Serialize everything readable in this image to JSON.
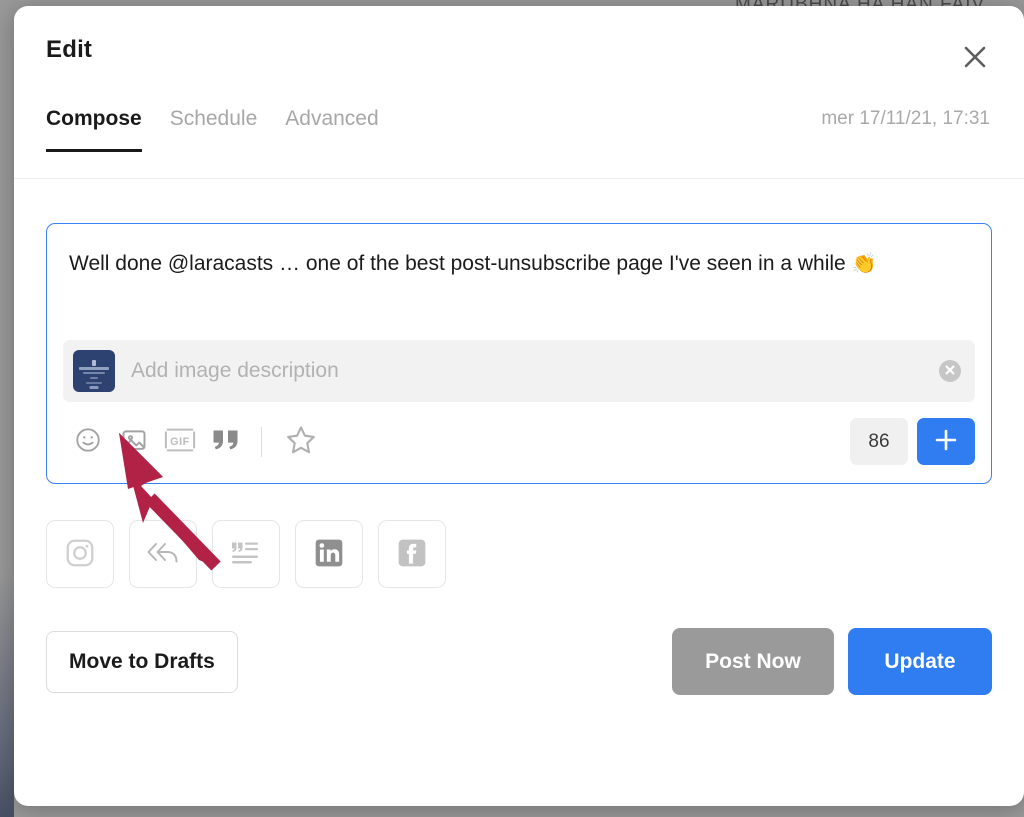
{
  "backdrop": {
    "cut_off_text": "MARUBHNA HA HAN FAIV"
  },
  "modal": {
    "title": "Edit",
    "close_icon": "close-icon",
    "tabs": [
      {
        "label": "Compose",
        "active": true
      },
      {
        "label": "Schedule",
        "active": false
      },
      {
        "label": "Advanced",
        "active": false
      }
    ],
    "timestamp": "mer 17/11/21, 17:31"
  },
  "compose": {
    "text": "Well done @laracasts … one of the best post-unsubscribe page I've seen in a while ",
    "emoji": "👏",
    "border_color": "#3b82f6"
  },
  "image_description": {
    "placeholder": "Add image description",
    "value": "",
    "thumbnail_name": "image-thumbnail",
    "thumbnail_color": "#2e4272",
    "clear_icon": "clear-circle-icon"
  },
  "toolbar": {
    "items": [
      {
        "name": "emoji-icon",
        "label": "Emoji"
      },
      {
        "name": "image-icon",
        "label": "Image"
      },
      {
        "name": "gif-icon",
        "label": "GIF"
      },
      {
        "name": "quote-icon",
        "label": "Quote"
      },
      {
        "name": "star-icon",
        "label": "Favorite"
      }
    ],
    "char_count": "86",
    "add_icon": "plus-icon",
    "add_color": "#2f7df0"
  },
  "networks": [
    {
      "name": "instagram-icon",
      "label": "Instagram"
    },
    {
      "name": "reply-all-icon",
      "label": "Reply All"
    },
    {
      "name": "quote-list-icon",
      "label": "Quote List"
    },
    {
      "name": "linkedin-icon",
      "label": "LinkedIn"
    },
    {
      "name": "facebook-icon",
      "label": "Facebook"
    }
  ],
  "footer": {
    "drafts_label": "Move to Drafts",
    "post_now_label": "Post Now",
    "post_now_color": "#9a9a9a",
    "update_label": "Update",
    "update_color": "#2f7df0"
  },
  "annotation": {
    "arrow_color": "#b22246"
  }
}
